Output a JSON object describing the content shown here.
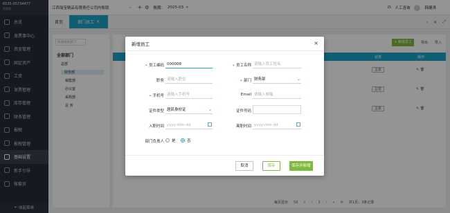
{
  "company": {
    "name": "江西瑞宝精品有限责任公司内账版"
  },
  "logo": {
    "text": "6535-05734477",
    "sub": "智能版"
  },
  "period": {
    "label": "账期：",
    "value": "2025-03"
  },
  "topbar": {
    "service": "人工咨询",
    "user": "韩健涛"
  },
  "sidebar": {
    "items": [
      {
        "label": "总览"
      },
      {
        "label": "发票事中心"
      },
      {
        "label": "资金管理"
      },
      {
        "label": "固定资产"
      },
      {
        "label": "工资"
      },
      {
        "label": "发票管理"
      },
      {
        "label": "库存管理"
      },
      {
        "label": "财务管理"
      },
      {
        "label": "报税"
      },
      {
        "label": "报税管理"
      },
      {
        "label": "基础设置"
      },
      {
        "label": "新手引导"
      },
      {
        "label": "帐套员"
      }
    ],
    "collapse": "收起菜单"
  },
  "tabs": {
    "home": "首页",
    "active": "部门员工",
    "close": "×"
  },
  "left_panel": {
    "search_placeholder": "快速搜索部门",
    "tree_title": "全部部门",
    "root": "总部",
    "items": [
      "财务部",
      "销售部",
      "办公室",
      "采购部",
      "总  务"
    ]
  },
  "toolbar": {
    "add": "+ 新增员工",
    "export": "导出",
    "import": "导入"
  },
  "table": {
    "status_header": "状态",
    "op_header": "操作",
    "rows": [
      {
        "status": "正常"
      },
      {
        "status": "正常"
      },
      {
        "status": "正常"
      }
    ]
  },
  "pager": {
    "per_page_label": "每页显示",
    "per_page": "50",
    "page": "1",
    "total": "共1页，3条记录"
  },
  "modal": {
    "title": "新增员工",
    "close": "×",
    "fields": {
      "code_label": "员工编码",
      "code_value": "000008",
      "name_label": "员工名称",
      "name_placeholder": "请输入员工姓名",
      "position_label": "职务",
      "position_placeholder": "请输入职位",
      "dept_label": "部门",
      "dept_value": "财务部",
      "phone_label": "手机号",
      "phone_placeholder": "请输入手机号",
      "email_label": "Email",
      "email_placeholder": "请输入邮箱",
      "idtype_label": "证件类型",
      "idtype_value": "居民身份证",
      "idno_label": "证件号码",
      "hire_label": "入职时间",
      "hire_placeholder": "yyyy-mm-dd",
      "leave_label": "离职时间",
      "leave_placeholder": "yyyy-mm-dd",
      "head_label": "部门负责人",
      "opt_yes": "是",
      "opt_no": "否"
    },
    "buttons": {
      "cancel": "取消",
      "save": "保存",
      "save_new": "保存并新增"
    }
  },
  "colors": {
    "accent": "#1aa3c8",
    "green": "#7dbb3b",
    "sidebar": "#262c36"
  }
}
